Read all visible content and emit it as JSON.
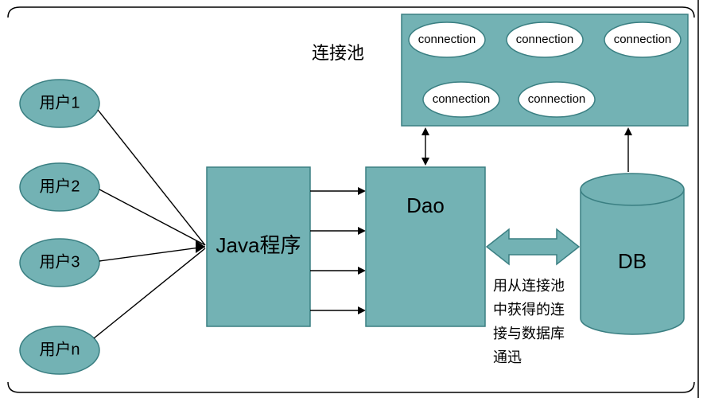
{
  "diagram": {
    "users": {
      "u1": "用户1",
      "u2": "用户2",
      "u3": "用户3",
      "u4": "用户n"
    },
    "java_program": "Java程序",
    "dao": "Dao",
    "db": "DB",
    "pool_label": "连接池",
    "connections": {
      "c1": "connection",
      "c2": "connection",
      "c3": "connection",
      "c4": "connection",
      "c5": "connection"
    },
    "note": {
      "l1": "用从连接池",
      "l2": "中获得的连",
      "l3": "接与数据库",
      "l4": "通迅"
    }
  },
  "chart_data": {
    "type": "diagram",
    "title": "",
    "nodes": [
      {
        "id": "user1",
        "label": "用户1",
        "shape": "ellipse"
      },
      {
        "id": "user2",
        "label": "用户2",
        "shape": "ellipse"
      },
      {
        "id": "user3",
        "label": "用户3",
        "shape": "ellipse"
      },
      {
        "id": "usern",
        "label": "用户n",
        "shape": "ellipse"
      },
      {
        "id": "java",
        "label": "Java程序",
        "shape": "rect"
      },
      {
        "id": "dao",
        "label": "Dao",
        "shape": "rect"
      },
      {
        "id": "db",
        "label": "DB",
        "shape": "cylinder"
      },
      {
        "id": "pool",
        "label": "连接池",
        "shape": "rect",
        "contains": [
          "connection",
          "connection",
          "connection",
          "connection",
          "connection"
        ]
      }
    ],
    "edges": [
      {
        "from": "user1",
        "to": "java",
        "style": "arrow"
      },
      {
        "from": "user2",
        "to": "java",
        "style": "arrow"
      },
      {
        "from": "user3",
        "to": "java",
        "style": "arrow"
      },
      {
        "from": "usern",
        "to": "java",
        "style": "arrow"
      },
      {
        "from": "java",
        "to": "dao",
        "style": "arrow",
        "multiplicity": 4
      },
      {
        "from": "dao",
        "to": "pool",
        "style": "double-arrow"
      },
      {
        "from": "db",
        "to": "pool",
        "style": "arrow"
      },
      {
        "from": "dao",
        "to": "db",
        "style": "double-arrow-wide",
        "note": "用从连接池中获得的连接与数据库通迅"
      }
    ]
  }
}
